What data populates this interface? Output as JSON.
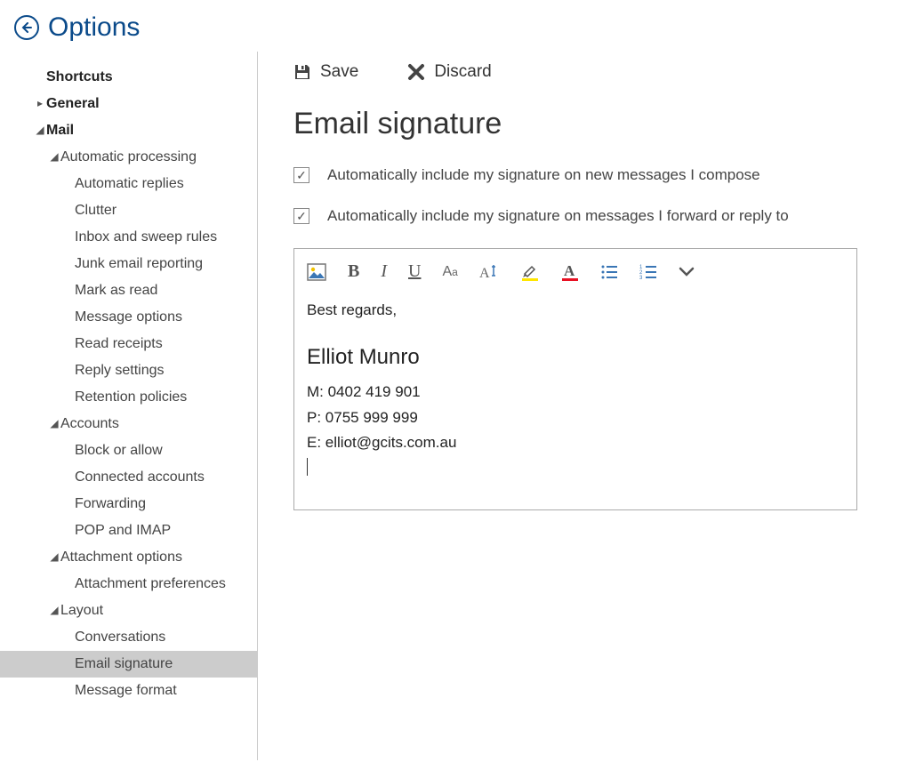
{
  "header": {
    "title": "Options"
  },
  "sidebar": {
    "shortcuts": "Shortcuts",
    "general": "General",
    "mail": "Mail",
    "auto_processing": "Automatic processing",
    "auto_replies": "Automatic replies",
    "clutter": "Clutter",
    "inbox_sweep": "Inbox and sweep rules",
    "junk": "Junk email reporting",
    "mark_read": "Mark as read",
    "msg_options": "Message options",
    "read_receipts": "Read receipts",
    "reply_settings": "Reply settings",
    "retention": "Retention policies",
    "accounts": "Accounts",
    "block_allow": "Block or allow",
    "connected": "Connected accounts",
    "forwarding": "Forwarding",
    "pop_imap": "POP and IMAP",
    "attachment_opts": "Attachment options",
    "attachment_prefs": "Attachment preferences",
    "layout": "Layout",
    "conversations": "Conversations",
    "email_signature": "Email signature",
    "message_format": "Message format"
  },
  "actions": {
    "save": "Save",
    "discard": "Discard"
  },
  "page": {
    "title": "Email signature"
  },
  "checkboxes": {
    "new_messages": {
      "checked": true,
      "label": "Automatically include my signature on new messages I compose"
    },
    "forward_reply": {
      "checked": true,
      "label": "Automatically include my signature on messages I forward or reply to"
    }
  },
  "toolbar_items": [
    "image-icon",
    "bold-icon",
    "italic-icon",
    "underline-icon",
    "font-size-icon",
    "font-style-icon",
    "highlight-icon",
    "font-color-icon",
    "bullet-list-icon",
    "number-list-icon",
    "expand-icon"
  ],
  "signature": {
    "greeting": "Best regards,",
    "name": "Elliot Munro",
    "mobile": "M: 0402 419 901",
    "phone": "P: 0755 999 999",
    "email": "E: elliot@gcits.com.au"
  }
}
